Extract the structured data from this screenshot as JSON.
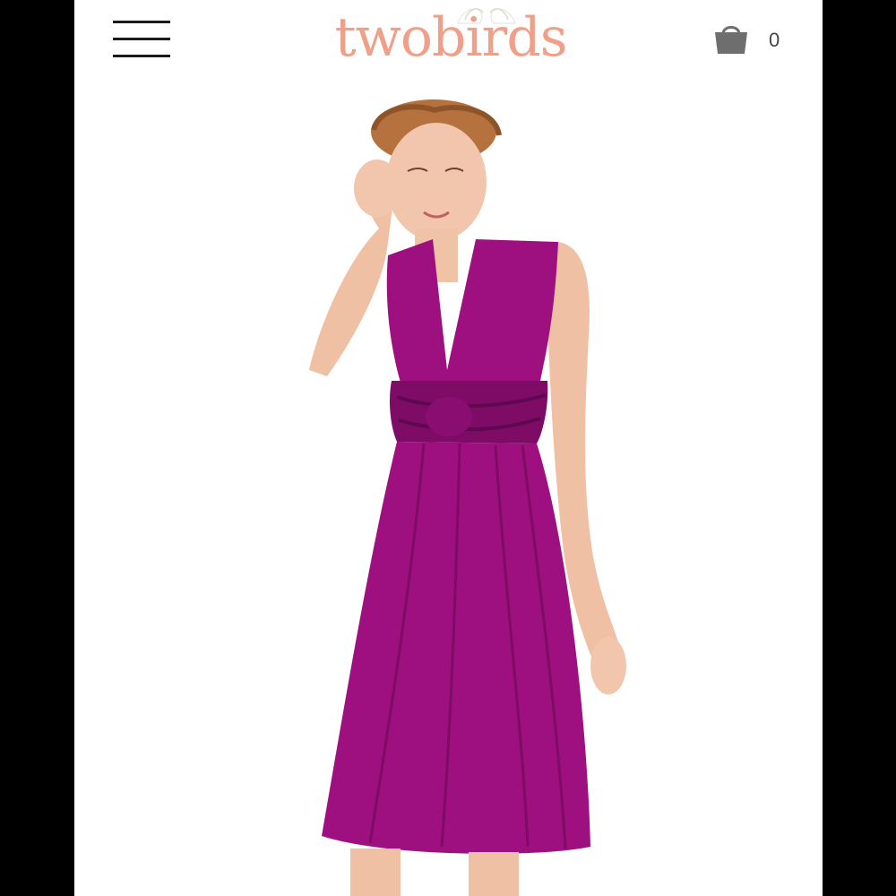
{
  "header": {
    "menu_icon": "hamburger-menu-icon",
    "logo": {
      "text": "twobirds",
      "color": "#f0a088",
      "birds_icon": "two-birds-icon"
    },
    "cart": {
      "icon": "shopping-bag-icon",
      "count": "0"
    }
  },
  "product": {
    "dress_color": "#9e1080"
  },
  "colors": {
    "page_background": "#ffffff",
    "frame_background": "#000000"
  }
}
